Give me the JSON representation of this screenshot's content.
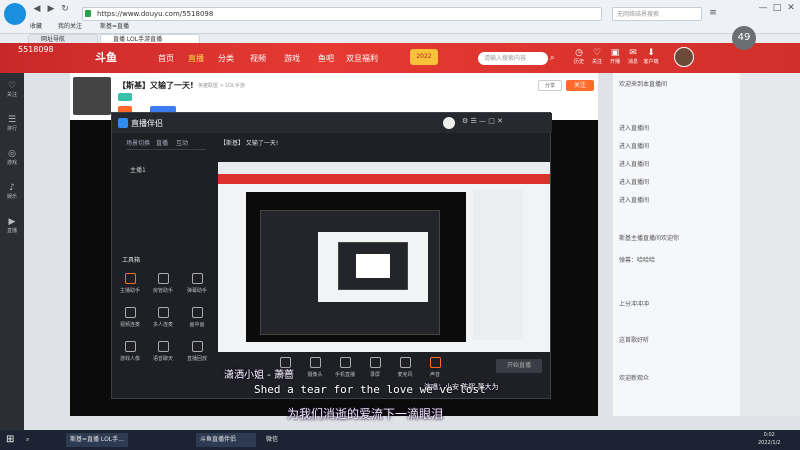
{
  "browser": {
    "url": "https://www.douyu.com/5518098",
    "web_search_placeholder": "无网络结界搜索",
    "bookmarks": [
      "收藏",
      "我的关注",
      "斯基=直播"
    ],
    "tabs": [
      "网址导航",
      "直播 LOL手游直播"
    ],
    "zoom_badge": "49"
  },
  "header": {
    "room_id": "5518098",
    "logo": "斗鱼",
    "nav": [
      "首页",
      "直播",
      "分类",
      "视频",
      "游戏",
      "鱼吧",
      "双旦福利"
    ],
    "nav_active_index": 1,
    "year": "2022",
    "search_placeholder": "请输入搜索内容",
    "icons": [
      "历史",
      "关注",
      "开播",
      "消息",
      "客户端",
      "我的",
      "鱼丸"
    ]
  },
  "sidebar": [
    "关注",
    "排行",
    "游戏",
    "娱乐",
    "直播"
  ],
  "room": {
    "title": "【斯基】又输了一天!",
    "category": "英雄联盟 > LOL手游",
    "follow_label": "关注",
    "share_label": "分享"
  },
  "app": {
    "name": "直播伴侣",
    "stream_title": "【斯基】 又输了一天!",
    "tabs": [
      "场景切换",
      "直播",
      "互动"
    ],
    "scene": "主播1",
    "toolbox": "工具箱",
    "tools": [
      "主播助手",
      "房管助手",
      "弹幕助手",
      "视频连麦",
      "多人连麦",
      "画中画",
      "游戏人像",
      "语音聊天",
      "直播回放"
    ],
    "bottom_tools": [
      "截图",
      "摄像头",
      "手机直播",
      "录屏",
      "麦克风",
      "声音"
    ],
    "start_label": "开始直播"
  },
  "subtitles": {
    "singer": "潇洒小姐 - 萧蔷",
    "english": "Shed a tear for the love we've lost",
    "singer2": "演唱：小安 陈熙 萧大为",
    "chinese": "为我们消逝的爱流下一滴眼泪"
  },
  "chat": {
    "messages": [
      "欢迎来到本直播间",
      "进入直播间",
      "进入直播间",
      "进入直播间",
      "进入直播间",
      "进入直播间",
      "斯基主播直播间欢迎你",
      "弹幕：哈哈哈",
      "上分冲冲冲",
      "这首歌好听",
      "欢迎新观众"
    ]
  },
  "taskbar": {
    "items": [
      "斯基=直播 LOL手...",
      "斗鱼直播伴侣",
      "微信"
    ],
    "time": "0:02",
    "date": "2022/1/2"
  }
}
